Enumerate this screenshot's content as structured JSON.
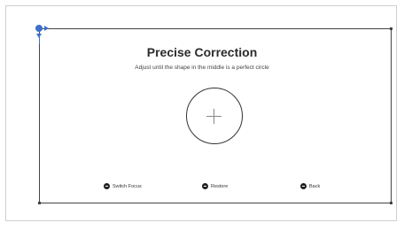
{
  "screen": {
    "title": "Precise Correction",
    "subtitle": "Adjust until the shape in the middle is a perfect circle"
  },
  "hints": [
    {
      "label": "Switch Focus",
      "icon": "button-icon"
    },
    {
      "label": "Restore",
      "icon": "button-icon"
    },
    {
      "label": "Back",
      "icon": "button-icon"
    }
  ],
  "colors": {
    "handle": "#3b6fc9",
    "frame": "#444444",
    "text": "#2b2b2b"
  }
}
